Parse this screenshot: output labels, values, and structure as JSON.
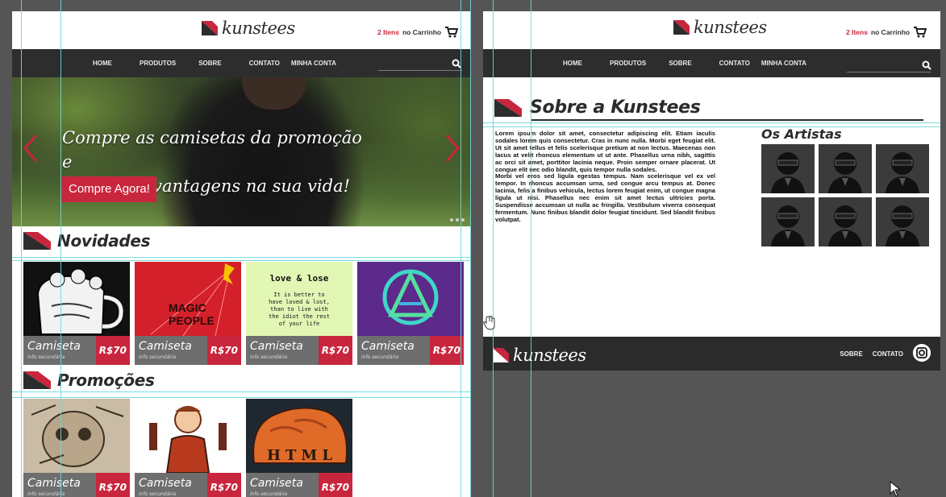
{
  "brand": {
    "logo_text": "kunstees",
    "accent_color": "#c8263d"
  },
  "header": {
    "cart_count": "2 Itens",
    "cart_label": "no Carrinho",
    "cart_icon": "shopping-cart-icon"
  },
  "nav": {
    "items": [
      "HOME",
      "PRODUTOS",
      "SOBRE",
      "CONTATO",
      "MINHA CONTA"
    ],
    "search_icon": "magnifier-icon"
  },
  "home": {
    "hero": {
      "title_line1": "Compre as camisetas da promoção e",
      "title_line2": "ganhe mil vantagens na sua vida!",
      "cta": "Compre Agora!"
    },
    "sections": {
      "novidades": "Novidades",
      "promocoes": "Promoções"
    },
    "novidades_products": [
      {
        "name": "Camiseta",
        "sub": "info secundária",
        "price": "R$70",
        "art": "skeleton-mug"
      },
      {
        "name": "Camiseta",
        "sub": "info secundária",
        "price": "R$70",
        "art": "magic-people"
      },
      {
        "name": "Camiseta",
        "sub": "info secundária",
        "price": "R$70",
        "art": "love-and-lose-poem"
      },
      {
        "name": "Camiseta",
        "sub": "info secundária",
        "price": "R$70",
        "art": "neon-triangle-logo"
      }
    ],
    "promocoes_products": [
      {
        "name": "Camiseta",
        "sub": "info secundária",
        "price": "R$70",
        "art": "skull-sketch"
      },
      {
        "name": "Camiseta",
        "sub": "info secundária",
        "price": "R$70",
        "art": "worker-illustration"
      },
      {
        "name": "Camiseta",
        "sub": "info secundária",
        "price": "R$70",
        "art": "html-brain"
      }
    ],
    "card_art_text": {
      "magic": "MAGIC",
      "people": "PEOPLE",
      "poem_title": "love & lose",
      "poem_lines": [
        "It is better to",
        "have loved & lost,",
        "than to live with",
        "the idiot the rest",
        "of your life"
      ],
      "html": "HTML"
    }
  },
  "about": {
    "title": "Sobre a Kunstees",
    "paragraph1": "Lorem ipsum dolor sit amet, consectetur adipiscing elit. Etiam iaculis sodales lorem quis consectetur. Cras in nunc nulla. Morbi eget feugiat elit. Ut sit amet tellus et felis scelerisque pretium at non lectus. Maecenas non lacus at velit rhoncus elementum ut ut ante. Phasellus urna nibh, sagittis ac orci sit amet, porttitor lacinia neque. Proin semper ornare placerat. Ut congue elit nec odio blandit, quis tempor nulla sodales.",
    "paragraph2": "Morbi vel eros sed ligula egestas tempus. Nam scelerisque vel ex vel tempor. In rhoncus accumsan urna, sed congue arcu tempus at. Donec lacinia, felis a finibus vehicula, lectus lorem feugiat enim, ut congue magna ligula ut nisi. Phasellus nec enim sit amet lectus ultricies porta. Suspendisse accumsan ut nulla ac fringilla. Vestibulum viverra consequat fermentum. Nunc finibus blandit dolor feugiat tincidunt. Sed blandit finibus volutpat.",
    "artists_title": "Os Artistas",
    "artist_count": 6,
    "footer": {
      "links": [
        "SOBRE",
        "CONTATO"
      ],
      "social_icon": "instagram-icon"
    }
  }
}
